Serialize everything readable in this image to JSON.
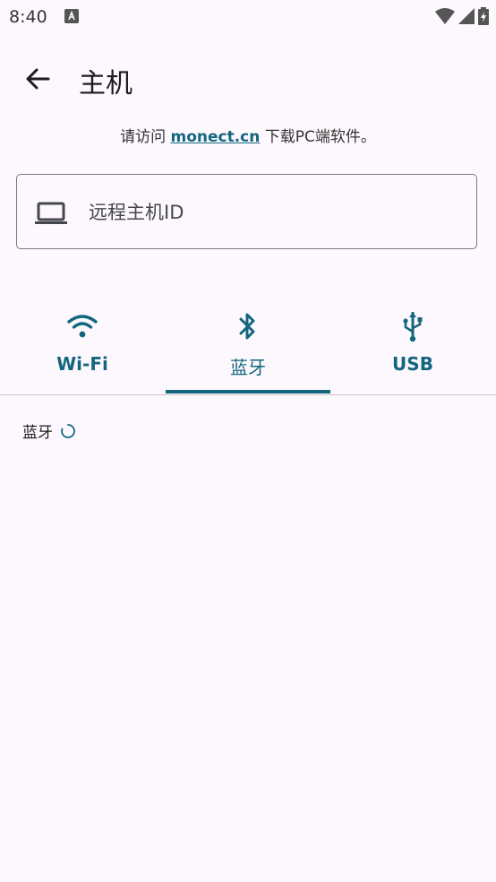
{
  "status": {
    "time": "8:40"
  },
  "app_bar": {
    "title": "主机"
  },
  "visit": {
    "prefix": "请访问 ",
    "link": "monect.cn",
    "suffix": " 下载PC端软件。"
  },
  "host_field": {
    "placeholder": "远程主机ID",
    "value": ""
  },
  "tabs": [
    {
      "label": "Wi-Fi",
      "icon": "wifi-icon"
    },
    {
      "label": "蓝牙",
      "icon": "bluetooth-icon"
    },
    {
      "label": "USB",
      "icon": "usb-icon"
    }
  ],
  "active_tab": "蓝牙",
  "bluetooth_section": {
    "title": "蓝牙"
  },
  "colors": {
    "accent": "#14667e",
    "background": "#fdf8fd"
  }
}
